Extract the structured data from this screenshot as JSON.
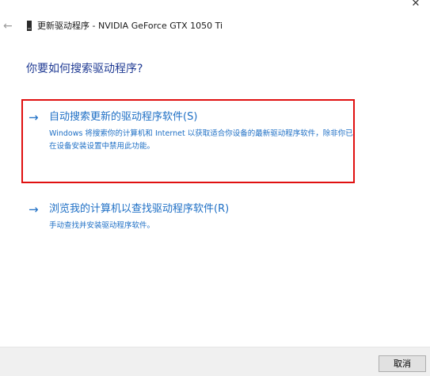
{
  "window": {
    "close_glyph": "✕",
    "back_glyph": "←",
    "title": "更新驱动程序 - NVIDIA GeForce GTX 1050 Ti",
    "device_icon": "device-icon"
  },
  "main": {
    "question": "你要如何搜索驱动程序?",
    "options": [
      {
        "arrow": "→",
        "title": "自动搜索更新的驱动程序软件(S)",
        "description": "Windows 将搜索你的计算机和 Internet 以获取适合你设备的最新驱动程序软件，除非你已在设备安装设置中禁用此功能。"
      },
      {
        "arrow": "→",
        "title": "浏览我的计算机以查找驱动程序软件(R)",
        "description": "手动查找并安装驱动程序软件。"
      }
    ],
    "highlight_color": "#e01010",
    "link_color": "#1e6fc5"
  },
  "footer": {
    "cancel_label": "取消"
  }
}
